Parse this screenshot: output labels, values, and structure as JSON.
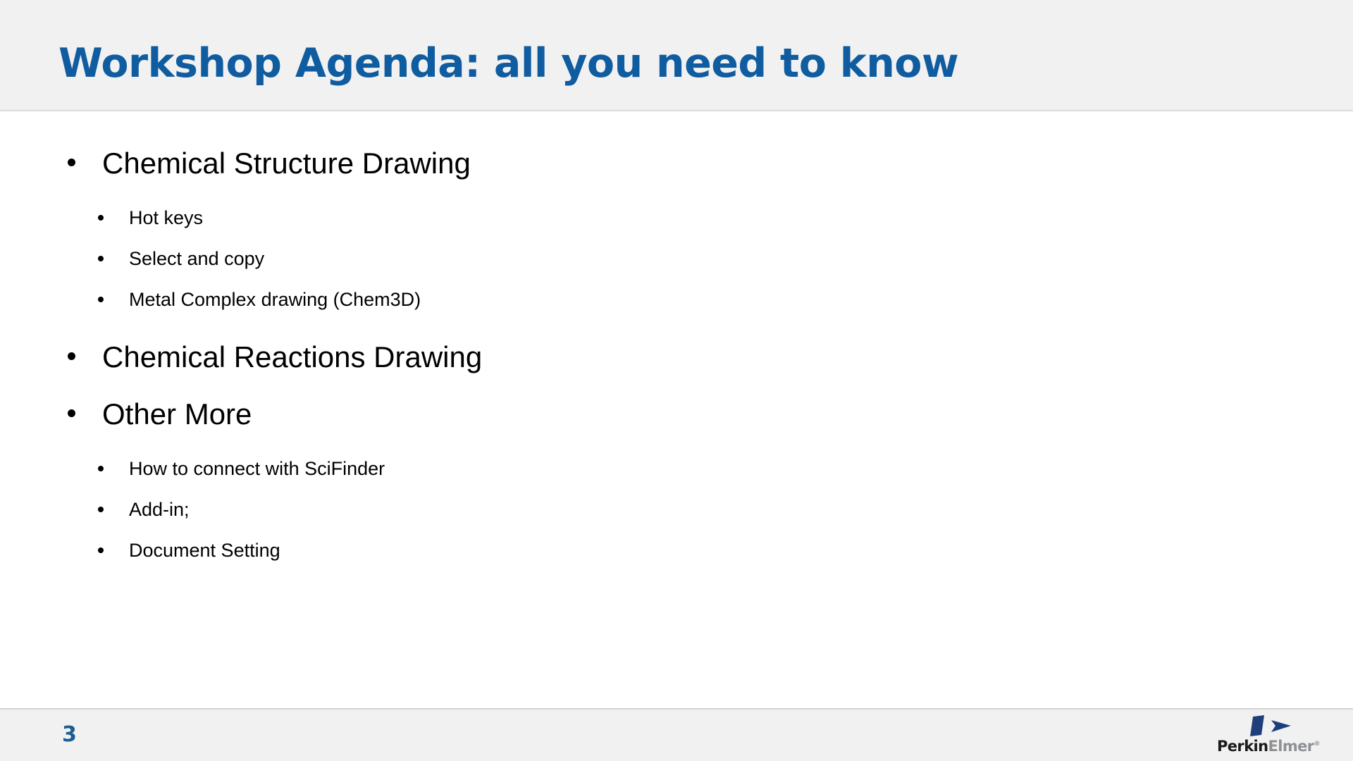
{
  "header": {
    "title": "Workshop Agenda: all you need to know",
    "title_color": "#0f5ca0",
    "background_color": "#f1f1f1"
  },
  "body": {
    "background_color": "#ffffff",
    "text_color": "#000000",
    "bullets": [
      {
        "level": 1,
        "text": "Chemical Structure Drawing"
      },
      {
        "level": 2,
        "text": "Hot keys"
      },
      {
        "level": 2,
        "text": "Select and copy"
      },
      {
        "level": 2,
        "text": "Metal Complex drawing (Chem3D)"
      },
      {
        "level": 1,
        "text": "Chemical Reactions Drawing"
      },
      {
        "level": 1,
        "text": "Other More"
      },
      {
        "level": 2,
        "text": "How to connect with SciFinder"
      },
      {
        "level": 2,
        "text": "Add-in;"
      },
      {
        "level": 2,
        "text": "Document Setting"
      }
    ]
  },
  "footer": {
    "slide_number": "3",
    "slide_number_color": "#1b5c94",
    "background_color": "#f1f1f1",
    "logo": {
      "name": "perkinelmer-logo",
      "wordmark_primary": "Perkin",
      "wordmark_secondary": "Elmer",
      "registered_mark": "®",
      "bar_color": "#1f3f7a",
      "arrow_color": "#1b3f7d",
      "primary_color": "#1a1a1a",
      "secondary_color": "#8e9194"
    }
  }
}
